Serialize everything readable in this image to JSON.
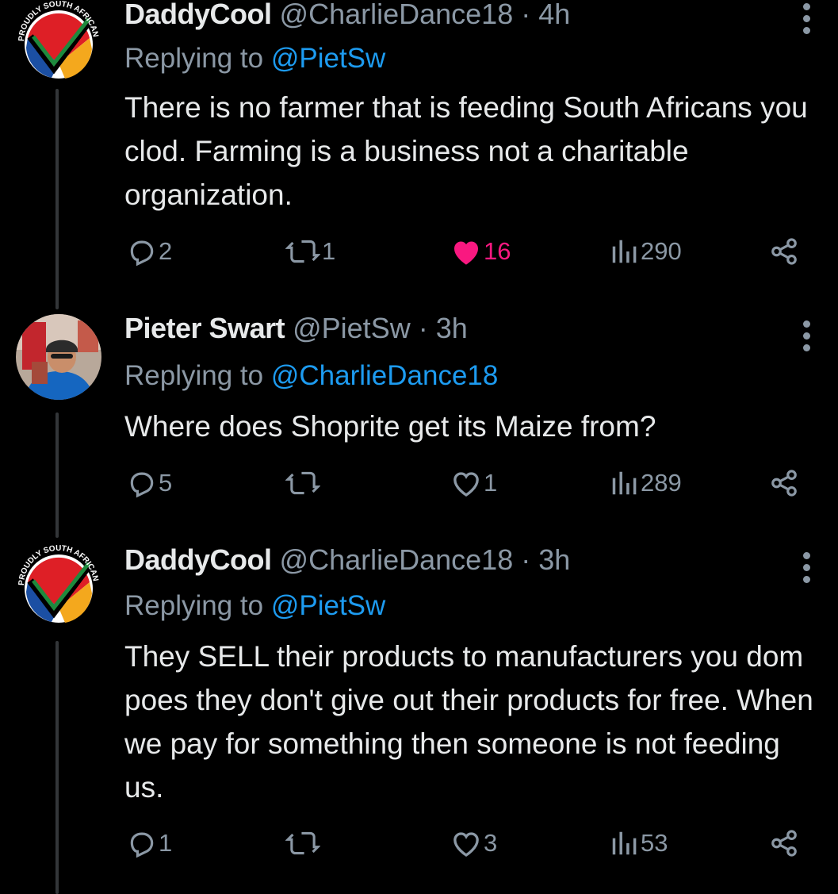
{
  "tweets": [
    {
      "name": "DaddyCool",
      "handle": "@CharlieDance18",
      "sep": "·",
      "time": "4h",
      "replying_prefix": "Replying to ",
      "replying_to": "@PietSw",
      "text": "There is no farmer that is feeding South Africans you clod. Farming is a business not a charitable organization.",
      "replies": "2",
      "retweets": "1",
      "likes": "16",
      "liked": true,
      "views": "290",
      "avatar": "proudly-south-african-logo"
    },
    {
      "name": "Pieter Swart",
      "handle": "@PietSw",
      "sep": "·",
      "time": "3h",
      "replying_prefix": "Replying to ",
      "replying_to": "@CharlieDance18",
      "text": "Where does Shoprite get its Maize from?",
      "replies": "5",
      "retweets": "",
      "likes": "1",
      "liked": false,
      "views": "289",
      "avatar": "user-photo"
    },
    {
      "name": "DaddyCool",
      "handle": "@CharlieDance18",
      "sep": "·",
      "time": "3h",
      "replying_prefix": "Replying to ",
      "replying_to": "@PietSw",
      "text": "They SELL their products to manufacturers you dom poes they don't give out their products for free. When we pay for something then someone is not feeding us.",
      "replies": "1",
      "retweets": "",
      "likes": "3",
      "liked": false,
      "views": "53",
      "avatar": "proudly-south-african-logo"
    }
  ],
  "avatar_logo": {
    "text": "PROUDLY SOUTH AFRICAN"
  },
  "colors": {
    "accent": "#1d9bf0",
    "like": "#f91880",
    "muted": "#8b98a5",
    "text": "#e7e9ea"
  }
}
